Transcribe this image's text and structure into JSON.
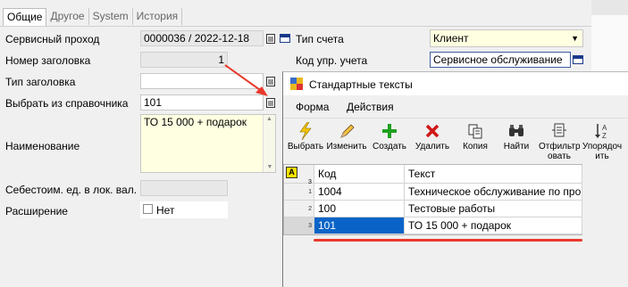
{
  "tabs": [
    "Общие",
    "Другое",
    "System",
    "История"
  ],
  "form": {
    "service_pass": {
      "label": "Сервисный проход",
      "value": "0000036 / 2022-12-18"
    },
    "header_number": {
      "label": "Номер заголовка",
      "value": "1"
    },
    "header_type": {
      "label": "Тип заголовка",
      "value": ""
    },
    "pick_from_ref": {
      "label": "Выбрать из справочника",
      "value": "101"
    },
    "name": {
      "label": "Наименование",
      "value": "ТО 15 000 + подарок"
    },
    "unit_cost": {
      "label": "Себестоим. ед. в лок. вал.",
      "value": ""
    },
    "extension": {
      "label": "Расширение",
      "value": "Нет"
    },
    "account_type": {
      "label": "Тип счета",
      "value": "Клиент"
    },
    "mgmt_code": {
      "label": "Код упр. учета",
      "value": "Сервисное обслуживание"
    }
  },
  "dialog": {
    "title": "Стандартные тексты",
    "menu": [
      "Форма",
      "Действия"
    ],
    "toolbar": [
      {
        "label": "Выбрать",
        "icon": "lightning-icon"
      },
      {
        "label": "Изменить",
        "icon": "pencil-icon"
      },
      {
        "label": "Создать",
        "icon": "plus-icon"
      },
      {
        "label": "Удалить",
        "icon": "delete-x-icon"
      },
      {
        "label": "Копия",
        "icon": "copy-icon"
      },
      {
        "label": "Найти",
        "icon": "binoculars-icon"
      },
      {
        "label": "Отфильтр\nовать",
        "icon": "filter-icon"
      },
      {
        "label": "Упорядоч\nить",
        "icon": "sort-icon"
      }
    ],
    "grid": {
      "corner_label": "A",
      "corner_num": "3",
      "columns": [
        "Код",
        "Текст"
      ],
      "rows": [
        {
          "num": "1",
          "code": "1004",
          "text": "Техническое обслуживание по про..."
        },
        {
          "num": "2",
          "code": "100",
          "text": "Тестовые работы"
        },
        {
          "num": "3",
          "code": "101",
          "text": "ТО 15 000 + подарок"
        }
      ]
    }
  },
  "colors": {
    "selected_row": "#0a64c8",
    "annotation": "#e8392b",
    "required_yellow": "#ffffe1"
  }
}
